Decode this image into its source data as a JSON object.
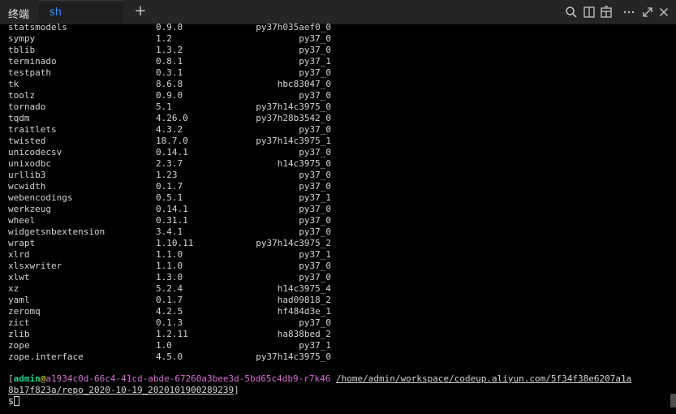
{
  "panel": {
    "title": "终端",
    "add_tab_label": "+",
    "tabs": [
      {
        "label": "sh"
      }
    ],
    "toolbar_icons": [
      "search-icon",
      "split-view-icon",
      "layout-icon",
      "more-icon",
      "expand-icon",
      "close-icon"
    ]
  },
  "packages": [
    {
      "name": "statsmodels",
      "version": "0.9.0",
      "build": "py37h035aef0_0"
    },
    {
      "name": "sympy",
      "version": "1.2",
      "build": "py37_0"
    },
    {
      "name": "tblib",
      "version": "1.3.2",
      "build": "py37_0"
    },
    {
      "name": "terminado",
      "version": "0.8.1",
      "build": "py37_1"
    },
    {
      "name": "testpath",
      "version": "0.3.1",
      "build": "py37_0"
    },
    {
      "name": "tk",
      "version": "8.6.8",
      "build": "hbc83047_0"
    },
    {
      "name": "toolz",
      "version": "0.9.0",
      "build": "py37_0"
    },
    {
      "name": "tornado",
      "version": "5.1",
      "build": "py37h14c3975_0"
    },
    {
      "name": "tqdm",
      "version": "4.26.0",
      "build": "py37h28b3542_0"
    },
    {
      "name": "traitlets",
      "version": "4.3.2",
      "build": "py37_0"
    },
    {
      "name": "twisted",
      "version": "18.7.0",
      "build": "py37h14c3975_1"
    },
    {
      "name": "unicodecsv",
      "version": "0.14.1",
      "build": "py37_0"
    },
    {
      "name": "unixodbc",
      "version": "2.3.7",
      "build": "h14c3975_0"
    },
    {
      "name": "urllib3",
      "version": "1.23",
      "build": "py37_0"
    },
    {
      "name": "wcwidth",
      "version": "0.1.7",
      "build": "py37_0"
    },
    {
      "name": "webencodings",
      "version": "0.5.1",
      "build": "py37_1"
    },
    {
      "name": "werkzeug",
      "version": "0.14.1",
      "build": "py37_0"
    },
    {
      "name": "wheel",
      "version": "0.31.1",
      "build": "py37_0"
    },
    {
      "name": "widgetsnbextension",
      "version": "3.4.1",
      "build": "py37_0"
    },
    {
      "name": "wrapt",
      "version": "1.10.11",
      "build": "py37h14c3975_2"
    },
    {
      "name": "xlrd",
      "version": "1.1.0",
      "build": "py37_1"
    },
    {
      "name": "xlsxwriter",
      "version": "1.1.0",
      "build": "py37_0"
    },
    {
      "name": "xlwt",
      "version": "1.3.0",
      "build": "py37_0"
    },
    {
      "name": "xz",
      "version": "5.2.4",
      "build": "h14c3975_4"
    },
    {
      "name": "yaml",
      "version": "0.1.7",
      "build": "had09818_2"
    },
    {
      "name": "zeromq",
      "version": "4.2.5",
      "build": "hf484d3e_1"
    },
    {
      "name": "zict",
      "version": "0.1.3",
      "build": "py37_0"
    },
    {
      "name": "zlib",
      "version": "1.2.11",
      "build": "ha838bed_2"
    },
    {
      "name": "zope",
      "version": "1.0",
      "build": "py37_1"
    },
    {
      "name": "zope.interface",
      "version": "4.5.0",
      "build": "py37h14c3975_0"
    }
  ],
  "prompt": {
    "open_bracket": "[",
    "user": "admin",
    "at": "@",
    "host": "a1934c0d-66c4-41cd-abde-67260a3bee3d-5bd65c4db9-r7k46",
    "space": " ",
    "path_line1": "/home/admin/workspace/codeup.aliyun.com/5f34f38e6207a1a",
    "path_line2": "8b17f823a/repo_2020-10-19_2020101900289239",
    "close_bracket": "]",
    "dollar": "$"
  },
  "colors": {
    "user": "#23d18b",
    "at": "#e5e510",
    "host": "#d670d6",
    "tab_label": "#3794ff"
  },
  "scrollbar": {
    "position": 0.95
  }
}
